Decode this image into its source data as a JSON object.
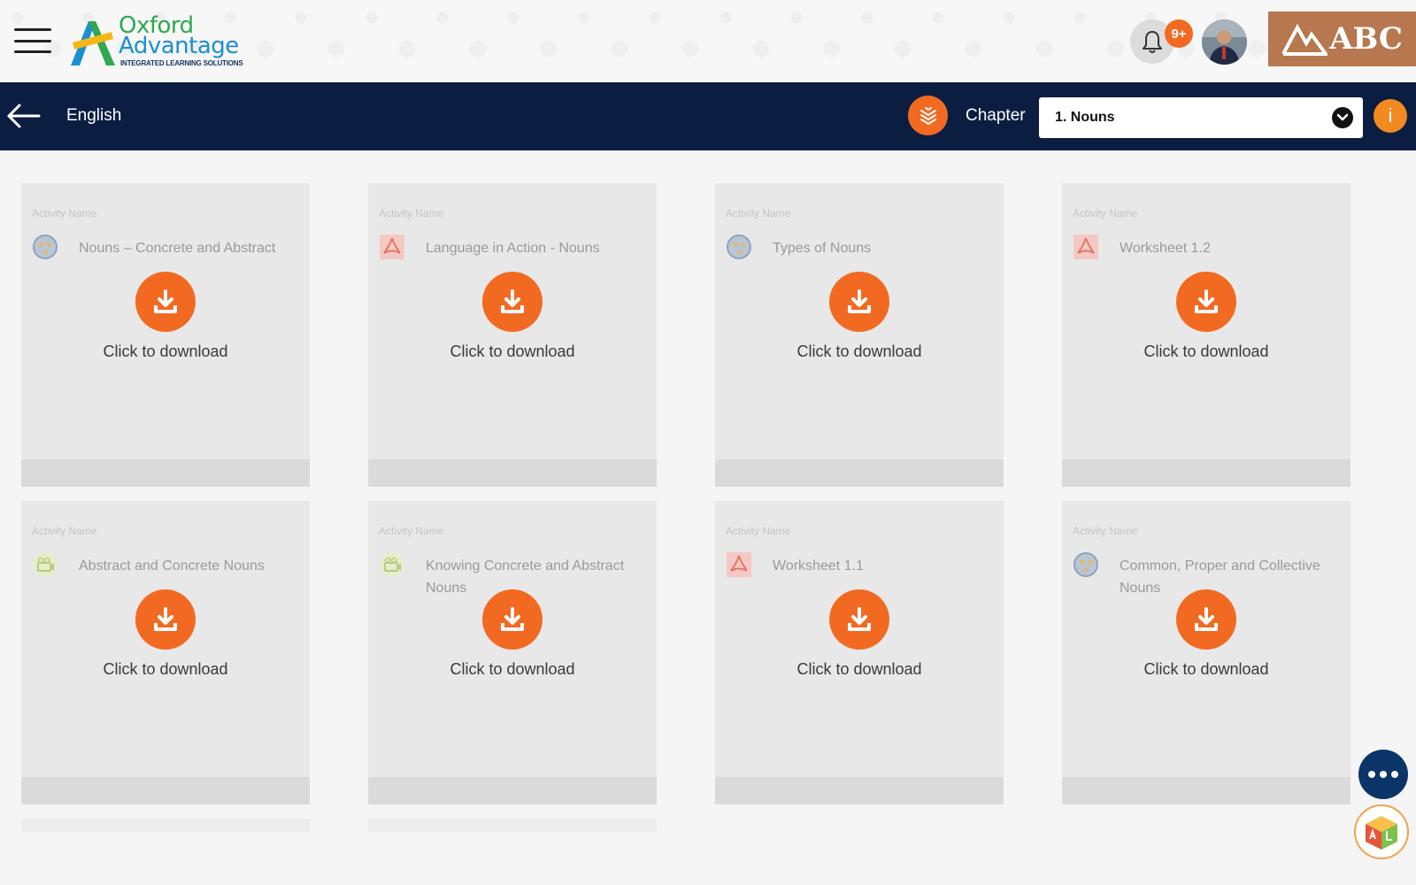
{
  "header": {
    "logo": {
      "line1": "Oxford",
      "line2": "Advantage",
      "tagline": "INTEGRATED LEARNING SOLUTIONS"
    },
    "notifications_badge": "9+",
    "school_logo_text": "ABC"
  },
  "navbar": {
    "subject": "English",
    "chapter_label": "Chapter",
    "chapter_selected": "1. Nouns"
  },
  "cards": [
    {
      "kicker": "Activity Name",
      "title": "Nouns – Concrete and Abstract",
      "type_icon": "globe-icon",
      "download_label": "Click to download"
    },
    {
      "kicker": "Activity Name",
      "title": "Language in Action - Nouns",
      "type_icon": "pdf-icon",
      "download_label": "Click to download"
    },
    {
      "kicker": "Activity Name",
      "title": "Types of Nouns",
      "type_icon": "globe-icon",
      "download_label": "Click to download"
    },
    {
      "kicker": "Activity Name",
      "title": "Worksheet 1.2",
      "type_icon": "pdf-icon",
      "download_label": "Click to download"
    },
    {
      "kicker": "Activity Name",
      "title": "Abstract and Concrete Nouns",
      "type_icon": "video-icon",
      "download_label": "Click to download"
    },
    {
      "kicker": "Activity Name",
      "title": "Knowing Concrete and Abstract Nouns",
      "type_icon": "video-icon",
      "download_label": "Click to download"
    },
    {
      "kicker": "Activity Name",
      "title": "Worksheet 1.1",
      "type_icon": "pdf-icon",
      "download_label": "Click to download"
    },
    {
      "kicker": "Activity Name",
      "title": "Common, Proper and Collective Nouns",
      "type_icon": "globe-icon",
      "download_label": "Click to download"
    }
  ],
  "colors": {
    "navbar": "#0b1e42",
    "accent": "#f26a21",
    "card_bg": "#e8e8e8",
    "fab_more": "#0b3468"
  }
}
